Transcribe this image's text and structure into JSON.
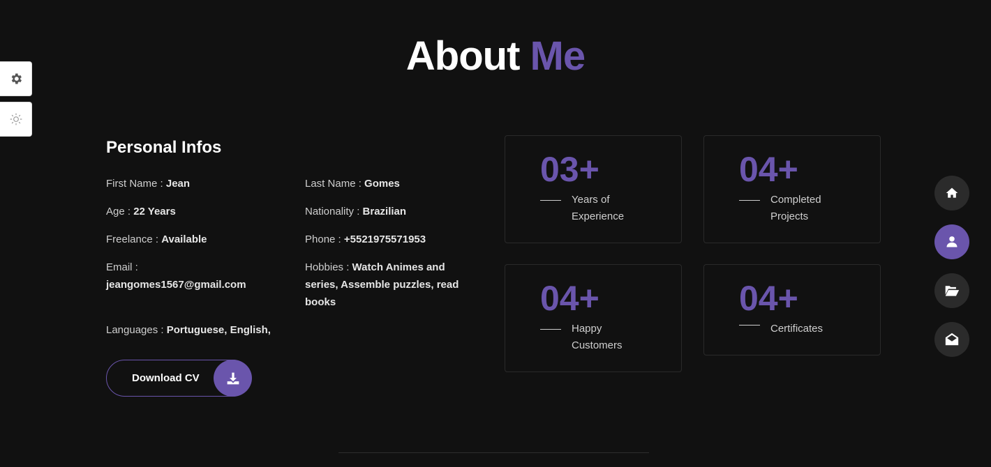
{
  "section": {
    "title_main": "About",
    "title_accent": "Me"
  },
  "tools": {
    "settings_icon": "gear-icon",
    "theme_icon": "sun-icon"
  },
  "personal": {
    "heading": "Personal Infos",
    "first_name_label": "First Name :",
    "first_name_value": "Jean",
    "last_name_label": "Last Name :",
    "last_name_value": "Gomes",
    "age_label": "Age :",
    "age_value": "22 Years",
    "nationality_label": "Nationality :",
    "nationality_value": "Brazilian",
    "freelance_label": "Freelance :",
    "freelance_value": "Available",
    "phone_label": "Phone :",
    "phone_value": "+5521975571953",
    "email_label": "Email :",
    "email_value": "jeangomes1567@gmail.com",
    "hobbies_label": "Hobbies :",
    "hobbies_value": "Watch Animes and series, Assemble puzzles, read books",
    "languages_label": "Languages :",
    "languages_value": "Portuguese, English,"
  },
  "cv_button": {
    "label": "Download CV",
    "icon": "download-icon"
  },
  "stats": [
    {
      "number": "03+",
      "caption_1": "Years of",
      "caption_2": "Experience"
    },
    {
      "number": "04+",
      "caption_1": "Completed",
      "caption_2": "Projects"
    },
    {
      "number": "04+",
      "caption_1": "Happy",
      "caption_2": "Customers"
    },
    {
      "number": "04+",
      "caption_1": "Certificates",
      "caption_2": ""
    }
  ],
  "nav": [
    {
      "icon": "home-icon",
      "active": false
    },
    {
      "icon": "user-icon",
      "active": true
    },
    {
      "icon": "folder-open-icon",
      "active": false
    },
    {
      "icon": "envelope-open-icon",
      "active": false
    }
  ],
  "colors": {
    "background": "#111111",
    "accent": "#6a55ac",
    "card_border": "#2a2a2a",
    "nav_button": "#2b2b2b"
  }
}
